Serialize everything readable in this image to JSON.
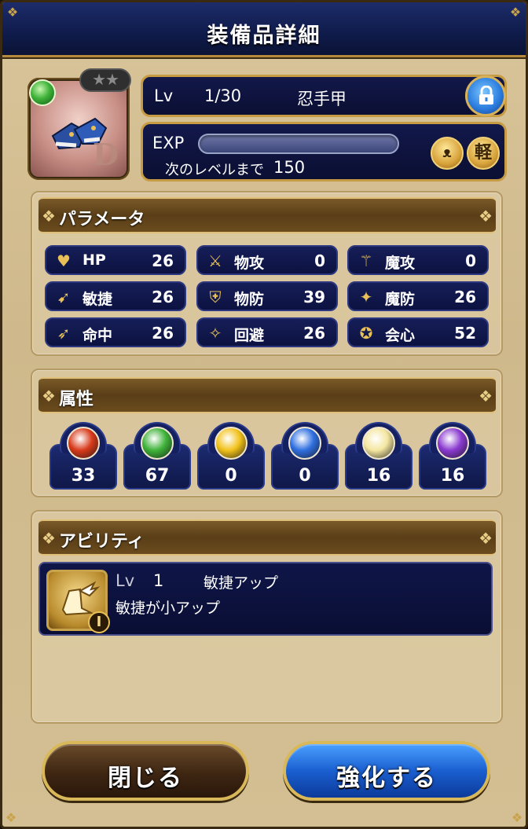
{
  "header": {
    "title": "装備品詳細"
  },
  "item": {
    "element_icon": "wind-orb-icon",
    "rank": "D",
    "stars": "★★",
    "level_label": "Lv",
    "level": "1/30",
    "name": "忍手甲",
    "exp_label": "EXP",
    "next_level_label": "次のレベルまで",
    "next_level_exp": "150",
    "weight_badge": "軽",
    "exp_progress": 0
  },
  "parameters": {
    "section_title": "パラメータ",
    "stats": [
      {
        "name": "HP",
        "value": "26",
        "icon": "heart-icon"
      },
      {
        "name": "物攻",
        "value": "0",
        "icon": "sword-icon"
      },
      {
        "name": "魔攻",
        "value": "0",
        "icon": "staff-icon"
      },
      {
        "name": "敏捷",
        "value": "26",
        "icon": "wing-boot-icon"
      },
      {
        "name": "物防",
        "value": "39",
        "icon": "shield-icon"
      },
      {
        "name": "魔防",
        "value": "26",
        "icon": "magic-defense-icon"
      },
      {
        "name": "命中",
        "value": "26",
        "icon": "bow-icon"
      },
      {
        "name": "回避",
        "value": "26",
        "icon": "evade-icon"
      },
      {
        "name": "会心",
        "value": "52",
        "icon": "critical-icon"
      }
    ]
  },
  "attributes": {
    "section_title": "属性",
    "values": [
      {
        "element": "fire",
        "value": "33",
        "color": "#d83a1a"
      },
      {
        "element": "wind",
        "value": "67",
        "color": "#3fb33a"
      },
      {
        "element": "thunder",
        "value": "0",
        "color": "#f2c21a"
      },
      {
        "element": "water",
        "value": "0",
        "color": "#2f6fe0"
      },
      {
        "element": "light",
        "value": "16",
        "color": "#f4e6a0"
      },
      {
        "element": "dark",
        "value": "16",
        "color": "#8a3ad0"
      }
    ]
  },
  "ability": {
    "section_title": "アビリティ",
    "level_label": "Lv",
    "level": "1",
    "name": "敏捷アップ",
    "description": "敏捷が小アップ",
    "tier": "I"
  },
  "buttons": {
    "close": "閉じる",
    "enhance": "強化する"
  }
}
